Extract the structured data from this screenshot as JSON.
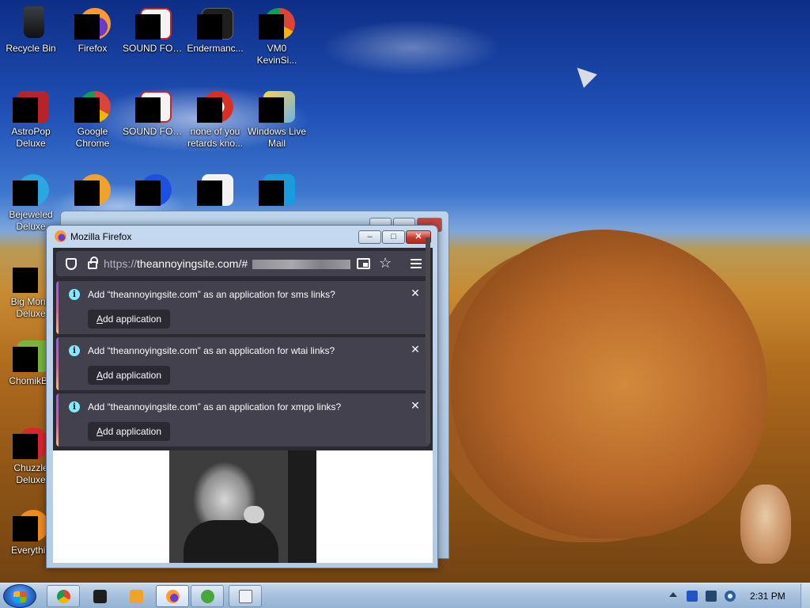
{
  "desktop": {
    "icons": [
      {
        "label": "Recycle Bin",
        "icon": "recycle-bin-icon"
      },
      {
        "label": "Firefox",
        "icon": "firefox-icon"
      },
      {
        "label": "SOUND FORGE Aud...",
        "icon": "sound-forge-icon"
      },
      {
        "label": "Endermanc...",
        "icon": "app-icon"
      },
      {
        "label": "VM0 KevinSi...",
        "icon": "chrome-icon"
      },
      {
        "label": "AstroPop Deluxe",
        "icon": "game-icon"
      },
      {
        "label": "Google Chrome",
        "icon": "chrome-icon"
      },
      {
        "label": "SOUND FORGE Aud...",
        "icon": "sound-forge-icon"
      },
      {
        "label": "none of you retards kno...",
        "icon": "shortcut-icon"
      },
      {
        "label": "Windows Live Mail",
        "icon": "mail-icon"
      },
      {
        "label": "Bejeweled Deluxe",
        "icon": "game-icon"
      },
      {
        "label": "Big Mone Deluxe",
        "icon": "game-icon"
      },
      {
        "label": "ChomikBo",
        "icon": "game-icon"
      },
      {
        "label": "Chuzzle Deluxe",
        "icon": "game-icon"
      },
      {
        "label": "Everythin",
        "icon": "search-app-icon"
      }
    ]
  },
  "window": {
    "title": "Mozilla Firefox",
    "minimize_glyph": "–",
    "maximize_glyph": "□",
    "close_glyph": "✕"
  },
  "browser": {
    "url_prefix": "https://",
    "url_host": "theannoyingsite.com/#",
    "star_glyph": "☆",
    "notifications": [
      {
        "message": "Add “theannoyingsite.com” as an application for sms links?",
        "button": "Add application",
        "button_key": "A",
        "button_rest": "dd application"
      },
      {
        "message": "Add “theannoyingsite.com” as an application for wtai links?",
        "button": "Add application",
        "button_key": "A",
        "button_rest": "dd application"
      },
      {
        "message": "Add “theannoyingsite.com” as an application for xmpp links?",
        "button": "Add application",
        "button_key": "A",
        "button_rest": "dd application"
      }
    ],
    "close_glyph": "✕",
    "info_glyph": "i"
  },
  "taskbar": {
    "clock": "2:31 PM",
    "items": [
      "chrome-icon",
      "app-icon",
      "media-player-icon",
      "firefox-icon",
      "green-app-icon",
      "document-icon"
    ]
  },
  "colors": {
    "firefox_toolbar": "#2b2a33",
    "notification_bg": "#42414d",
    "info_accent": "#80ebff",
    "close_button": "#c7392c"
  }
}
